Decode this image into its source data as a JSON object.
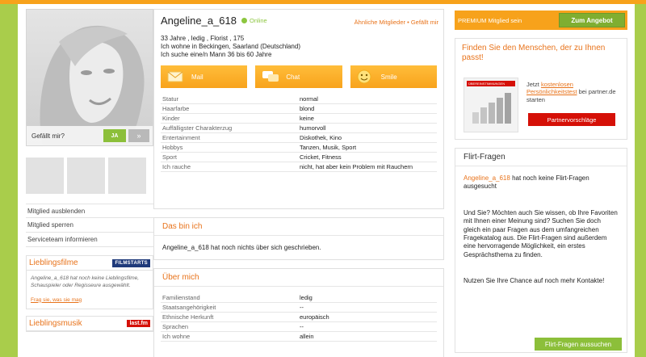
{
  "profile": {
    "name": "Angeline_a_618",
    "status": "Online",
    "similar_links": "Ähnliche Mitglieder • Gefällt mir",
    "info_line1": "33 Jahre , ledig , Florist , 175",
    "info_line2": "Ich wohne in Beckingen, Saarland (Deutschland)",
    "info_line3": "Ich suche eine/n Mann 36 bis 60 Jahre"
  },
  "actions": {
    "mail": "Mail",
    "chat": "Chat",
    "smile": "Smile"
  },
  "attributes": [
    {
      "k": "Statur",
      "v": "normal"
    },
    {
      "k": "Haarfarbe",
      "v": "blond"
    },
    {
      "k": "Kinder",
      "v": "keine"
    },
    {
      "k": "Auffälligster Charakterzug",
      "v": "humorvoll"
    },
    {
      "k": "Entertainment",
      "v": "Diskothek, Kino"
    },
    {
      "k": "Hobbys",
      "v": "Tanzen, Musik, Sport"
    },
    {
      "k": "Sport",
      "v": "Cricket, Fitness"
    },
    {
      "k": "Ich rauche",
      "v": "nicht, hat aber kein Problem mit Rauchern"
    }
  ],
  "left": {
    "like_question": "Gefällt mir?",
    "like_yes": "JA",
    "like_next": "»",
    "links": [
      "Mitglied ausblenden",
      "Mitglied sperren",
      "Serviceteam informieren"
    ],
    "films": {
      "title": "Lieblingsfilme",
      "logo": "FILMSTARTS",
      "text": "Angeline_a_618 hat noch keine Lieblingsfilme, Schauspieler oder Regisseure ausgewählt.",
      "link": "Frag sie, was sie mag"
    },
    "music": {
      "title": "Lieblingsmusik",
      "logo": "last.fm"
    }
  },
  "about_me_short": {
    "title": "Das bin ich",
    "text": "Angeline_a_618 hat noch nichts über sich geschrieben."
  },
  "about_me": {
    "title": "Über mich",
    "rows": [
      {
        "k": "Familienstand",
        "v": "ledig"
      },
      {
        "k": "Staatsangehörigkeit",
        "v": "--"
      },
      {
        "k": "Ethnische Herkunft",
        "v": "europäisch"
      },
      {
        "k": "Sprachen",
        "v": "--"
      },
      {
        "k": "Ich wohne",
        "v": "allein"
      }
    ]
  },
  "right": {
    "premium_text": "PREMIUM Mitglied sein",
    "premium_button": "Zum Angebot",
    "promo_title": "Finden Sie den Menschen, der zu Ihnen passt!",
    "promo_image_label": "ÜBEREINSTIMMUNGEN",
    "promo_text_pre": "Jetzt",
    "promo_text_hl": "kostenlosen Persönlichkeitstest",
    "promo_text_post": "bei partner.de starten",
    "promo_button": "Partnervorschläge",
    "flirt_title": "Flirt-Fragen",
    "flirt_user": "Angeline_a_618",
    "flirt_p1_rest": " hat noch keine Flirt-Fragen ausgesucht",
    "flirt_p2": "Und Sie? Möchten auch Sie wissen, ob Ihre Favoriten mit Ihnen einer Meinung sind? Suchen Sie doch gleich ein paar Fragen aus dem umfangreichen Fragekatalog aus. Die Flirt-Fragen sind außerdem eine hervorragende Möglichkeit, ein erstes Gesprächsthema zu finden.",
    "flirt_p3": "Nutzen Sie Ihre Chance auf noch mehr Kontakte!",
    "flirt_button": "Flirt-Fragen aussuchen"
  },
  "colors": {
    "page_bg": "#a9cd4b",
    "accent_orange": "#f7a21b",
    "link_orange": "#e8731b",
    "green_button": "#8cbf3a",
    "red_button": "#d51007"
  }
}
